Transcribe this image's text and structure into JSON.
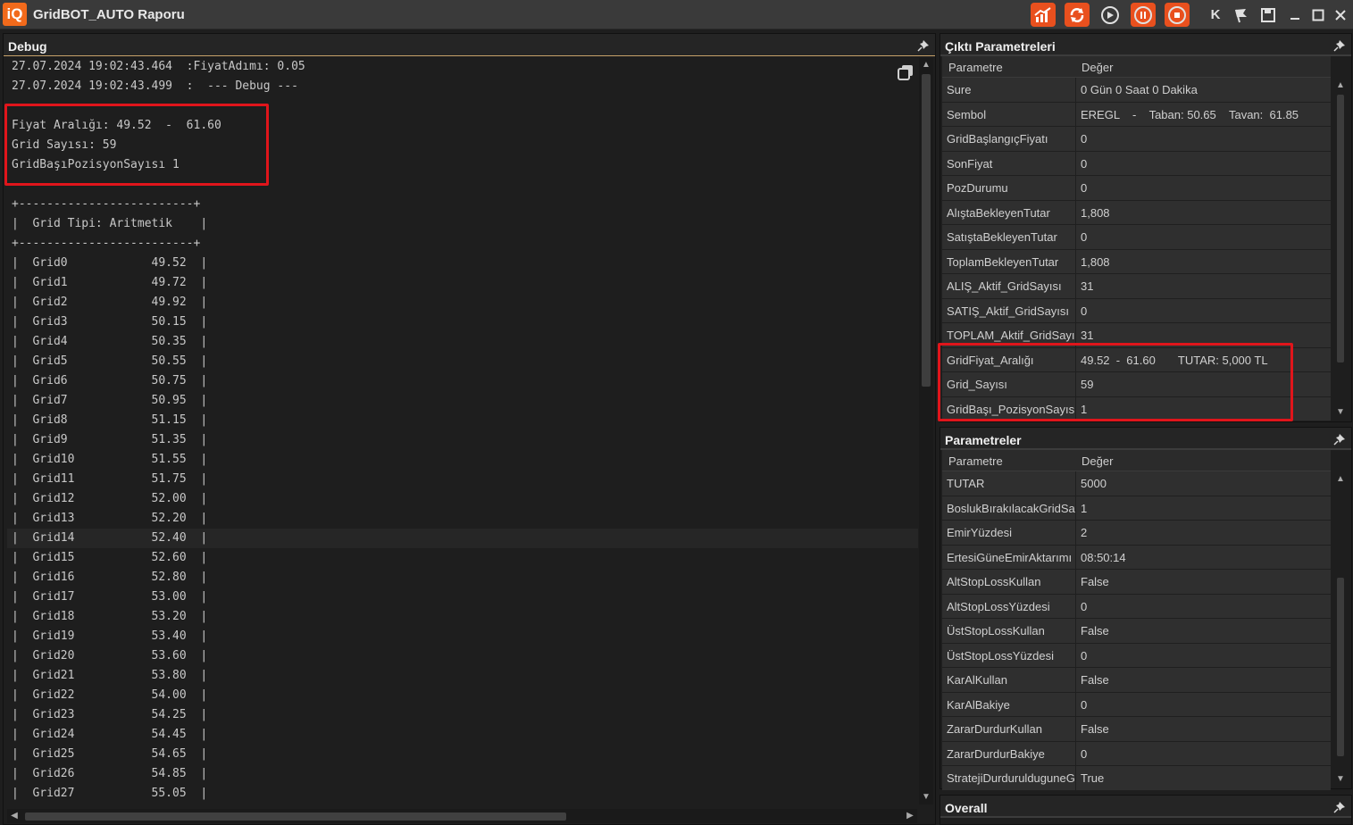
{
  "window": {
    "logo_text": "iQ",
    "title": "GridBOT_AUTO Raporu",
    "letter_button": "K"
  },
  "debug_panel": {
    "title": "Debug",
    "lines": [
      "27.07.2024 19:02:43.464  :FiyatAdımı: 0.05",
      "27.07.2024 19:02:43.499  :  --- Debug ---",
      "",
      "Fiyat Aralığı: 49.52  -  61.60",
      "Grid Sayısı: 59",
      "GridBaşıPozisyonSayısı 1",
      "",
      "+-------------------------+",
      "|  Grid Tipi: Aritmetik    |",
      "+-------------------------+",
      "|  Grid0            49.52  |",
      "|  Grid1            49.72  |",
      "|  Grid2            49.92  |",
      "|  Grid3            50.15  |",
      "|  Grid4            50.35  |",
      "|  Grid5            50.55  |",
      "|  Grid6            50.75  |",
      "|  Grid7            50.95  |",
      "|  Grid8            51.15  |",
      "|  Grid9            51.35  |",
      "|  Grid10           51.55  |",
      "|  Grid11           51.75  |",
      "|  Grid12           52.00  |",
      "|  Grid13           52.20  |",
      "|  Grid14           52.40  |",
      "|  Grid15           52.60  |",
      "|  Grid16           52.80  |",
      "|  Grid17           53.00  |",
      "|  Grid18           53.20  |",
      "|  Grid19           53.40  |",
      "|  Grid20           53.60  |",
      "|  Grid21           53.80  |",
      "|  Grid22           54.00  |",
      "|  Grid23           54.25  |",
      "|  Grid24           54.45  |",
      "|  Grid25           54.65  |",
      "|  Grid26           54.85  |",
      "|  Grid27           55.05  |"
    ]
  },
  "output_params": {
    "title": "Çıktı Parametreleri",
    "col_param": "Parametre",
    "col_value": "Değer",
    "rows": [
      {
        "name": "Sure",
        "value": "0 Gün 0 Saat 0 Dakika"
      },
      {
        "name": "Sembol",
        "value": "EREGL    -    Taban: 50.65    Tavan:  61.85"
      },
      {
        "name": "GridBaşlangıçFiyatı",
        "value": "0"
      },
      {
        "name": "SonFiyat",
        "value": "0"
      },
      {
        "name": "PozDurumu",
        "value": "0"
      },
      {
        "name": "AlıştaBekleyenTutar",
        "value": "1,808"
      },
      {
        "name": "SatıştaBekleyenTutar",
        "value": "0"
      },
      {
        "name": "ToplamBekleyenTutar",
        "value": "1,808"
      },
      {
        "name": "ALIŞ_Aktif_GridSayısı",
        "value": "31"
      },
      {
        "name": "SATIŞ_Aktif_GridSayısı",
        "value": "0"
      },
      {
        "name": "TOPLAM_Aktif_GridSayısı",
        "value": "31"
      },
      {
        "name": "GridFiyat_Aralığı",
        "value": "49.52  -  61.60       TUTAR: 5,000 TL"
      },
      {
        "name": "Grid_Sayısı",
        "value": "59"
      },
      {
        "name": "GridBaşı_PozisyonSayısı",
        "value": "1"
      }
    ]
  },
  "params": {
    "title": "Parametreler",
    "col_param": "Parametre",
    "col_value": "Değer",
    "rows": [
      {
        "name": "TUTAR",
        "value": "5000"
      },
      {
        "name": "BoslukBırakılacakGridSayısı",
        "value": "1"
      },
      {
        "name": "EmirYüzdesi",
        "value": "2"
      },
      {
        "name": "ErtesiGüneEmirAktarımı",
        "value": "08:50:14"
      },
      {
        "name": "AltStopLossKullan",
        "value": "False"
      },
      {
        "name": "AltStopLossYüzdesi",
        "value": "0"
      },
      {
        "name": "ÜstStopLossKullan",
        "value": "False"
      },
      {
        "name": "ÜstStopLossYüzdesi",
        "value": "0"
      },
      {
        "name": "KarAlKullan",
        "value": "False"
      },
      {
        "name": "KarAlBakiye",
        "value": "0"
      },
      {
        "name": "ZararDurdurKullan",
        "value": "False"
      },
      {
        "name": "ZararDurdurBakiye",
        "value": "0"
      },
      {
        "name": "StratejiDurdurulduguneGöre",
        "value": "True"
      }
    ]
  },
  "overall": {
    "title": "Overall"
  },
  "colors": {
    "accent_orange": "#e9501e",
    "highlight_red": "#e0151b"
  }
}
